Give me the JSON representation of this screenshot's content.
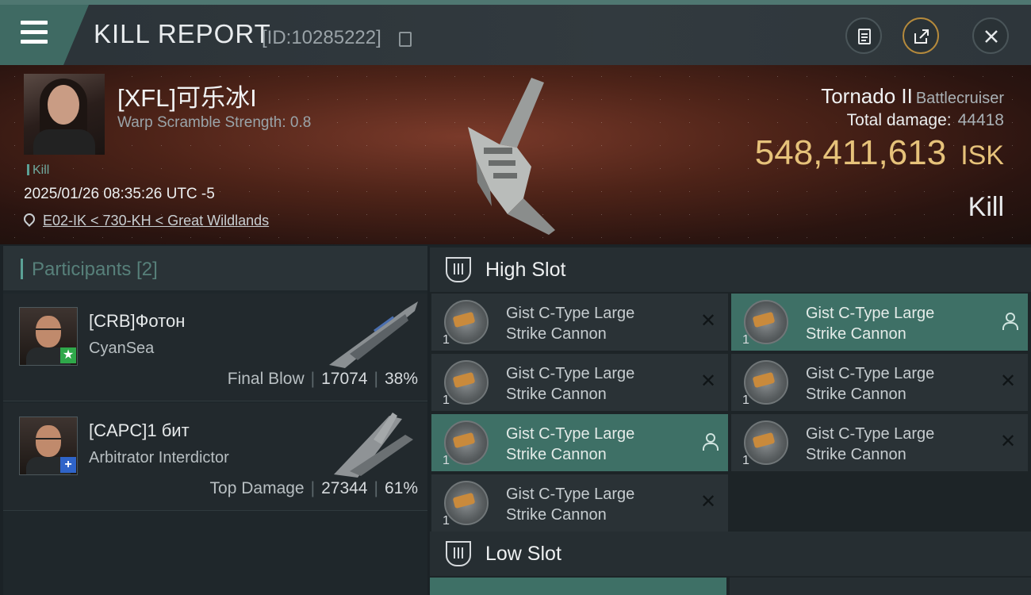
{
  "header": {
    "title": "KILL REPORT",
    "report_id": "[ID:10285222]"
  },
  "victim": {
    "name": "[XFL]可乐冰I",
    "scramble": "Warp Scramble Strength: 0.8",
    "tag": "Kill",
    "datetime": "2025/01/26 08:35:26 UTC -5",
    "location": "E02-IK < 730-KH < Great Wildlands",
    "ship_name": "Tornado II",
    "ship_class": "Battlecruiser",
    "total_damage_label": "Total damage:",
    "total_damage": "44418",
    "isk_value": "548,411,613",
    "isk_unit": "ISK",
    "result": "Kill"
  },
  "participants": {
    "header": "Participants [2]",
    "rows": [
      {
        "name": "[CRB]Фотон",
        "sub": "CyanSea",
        "role": "Final Blow",
        "damage": "17074",
        "percent": "38%"
      },
      {
        "name": "[CAPC]1 бит",
        "sub": "Arbitrator Interdictor",
        "role": "Top Damage",
        "damage": "27344",
        "percent": "61%"
      }
    ]
  },
  "slots": {
    "high_title": "High Slot",
    "low_title": "Low Slot",
    "modules": [
      {
        "line1": "Gist C-Type Large",
        "line2": "Strike Cannon",
        "qty": "1"
      },
      {
        "line1": "Gist C-Type Large",
        "line2": "Strike Cannon",
        "qty": "1"
      },
      {
        "line1": "Gist C-Type Large",
        "line2": "Strike Cannon",
        "qty": "1"
      },
      {
        "line1": "Gist C-Type Large",
        "line2": "Strike Cannon",
        "qty": "1"
      },
      {
        "line1": "Gist C-Type Large",
        "line2": "Strike Cannon",
        "qty": "1"
      },
      {
        "line1": "Gist C-Type Large",
        "line2": "Strike Cannon",
        "qty": "1"
      },
      {
        "line1": "Gist C-Type Large",
        "line2": "Strike Cannon",
        "qty": "1"
      }
    ]
  },
  "icons": {
    "menu": "hamburger-icon",
    "copy": "copy-icon",
    "clipboard": "clipboard-icon",
    "share": "share-icon",
    "close": "close-icon",
    "location": "map-pin-icon",
    "slot": "slot-icon",
    "drop": "dropped-person-icon",
    "destroyed": "destroyed-x-icon"
  },
  "colors": {
    "accent": "#5ba196",
    "highlight": "#3e7066",
    "isk": "#e6c27a"
  }
}
